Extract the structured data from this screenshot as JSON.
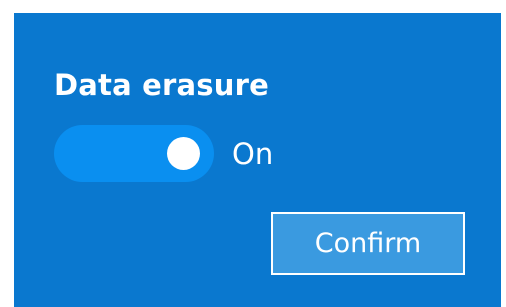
{
  "setting": {
    "title": "Data erasure",
    "toggle": {
      "state": true,
      "state_label": "On"
    }
  },
  "actions": {
    "confirm_label": "Confirm"
  },
  "colors": {
    "panel_background": "#0a78cf",
    "toggle_track": "#0a8ff0",
    "toggle_knob": "#ffffff",
    "button_background": "#3a9ae0",
    "text": "#ffffff"
  }
}
